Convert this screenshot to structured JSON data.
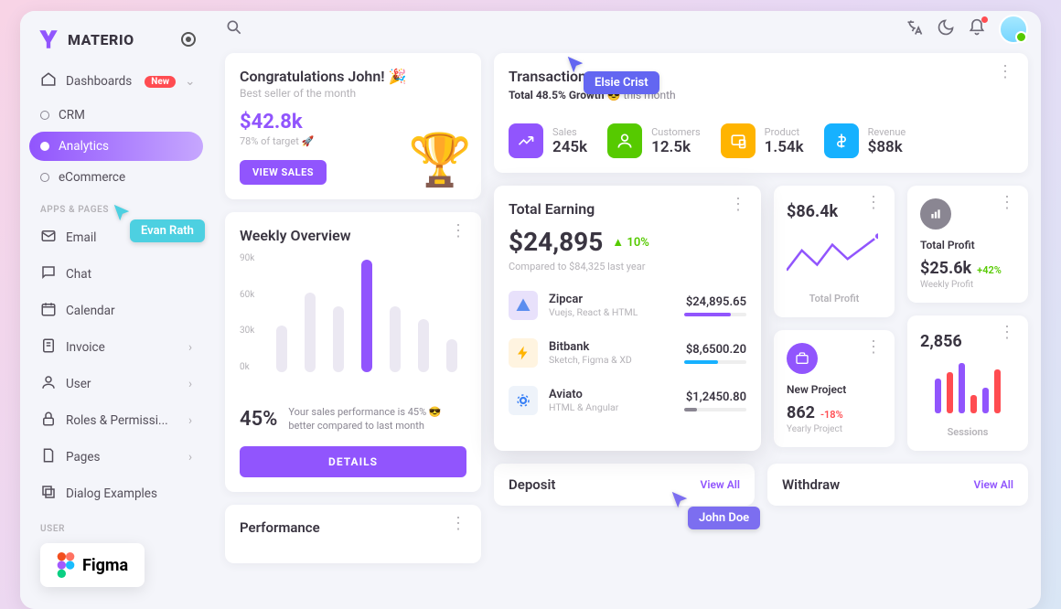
{
  "brand": "MATERIO",
  "sidebar": {
    "dashboards": "Dashboards",
    "new_badge": "New",
    "crm": "CRM",
    "analytics": "Analytics",
    "ecommerce": "eCommerce",
    "apps_pages": "APPS & PAGES",
    "email": "Email",
    "chat": "Chat",
    "calendar": "Calendar",
    "invoice": "Invoice",
    "user": "User",
    "roles": "Roles & Permissi...",
    "pages": "Pages",
    "dialog": "Dialog Examples",
    "ui_section": "USER"
  },
  "congrats": {
    "title": "Congratulations John! 🎉",
    "subtitle": "Best seller of the month",
    "value": "$42.8k",
    "target": "78% of target 🚀",
    "button": "VIEW SALES"
  },
  "weekly": {
    "title": "Weekly Overview",
    "ylabels": [
      "90k",
      "60k",
      "30k",
      "0k"
    ],
    "percent": "45%",
    "text": "Your sales performance is 45% 😎 better compared to last month",
    "button": "DETAILS"
  },
  "performance": {
    "title": "Performance"
  },
  "transactions": {
    "title": "Transactions",
    "growth_prefix": "Total 48.5% Growth",
    "growth_emoji": "😎",
    "growth_suffix": "this month",
    "stats": [
      {
        "label": "Sales",
        "value": "245k",
        "color": "#9155FD",
        "icon": "trend"
      },
      {
        "label": "Customers",
        "value": "12.5k",
        "color": "#56CA00",
        "icon": "user"
      },
      {
        "label": "Product",
        "value": "1.54k",
        "color": "#FFB400",
        "icon": "device"
      },
      {
        "label": "Revenue",
        "value": "$88k",
        "color": "#16B1FF",
        "icon": "dollar"
      }
    ]
  },
  "earning": {
    "title": "Total Earning",
    "value": "$24,895",
    "growth": "10%",
    "compared": "Compared to $84,325 last year",
    "rows": [
      {
        "name": "Zipcar",
        "tech": "Vuejs, React & HTML",
        "amount": "$24,895.65",
        "color": "#9155FD",
        "fill": 75,
        "bg": "#e8e1fb"
      },
      {
        "name": "Bitbank",
        "tech": "Sketch, Figma & XD",
        "amount": "$8,6500.20",
        "color": "#16B1FF",
        "fill": 55,
        "bg": "#fff4e0"
      },
      {
        "name": "Aviato",
        "tech": "HTML & Angular",
        "amount": "$1,2450.80",
        "color": "#8a8692",
        "fill": 20,
        "bg": "#eef3fa"
      }
    ]
  },
  "small1": {
    "value": "$86.4k",
    "label": "Total Profit"
  },
  "small2": {
    "label": "Total Profit",
    "value": "$25.6k",
    "growth": "+42%",
    "sub": "Weekly Profit"
  },
  "small3": {
    "label": "New Project",
    "value": "862",
    "growth": "-18%",
    "sub": "Yearly Project"
  },
  "small4": {
    "value": "2,856",
    "label": "Sessions"
  },
  "deposit": {
    "title": "Deposit",
    "viewall": "View All"
  },
  "withdraw": {
    "title": "Withdraw",
    "viewall": "View All"
  },
  "cursors": {
    "elsie": "Elsie Crist",
    "evan": "Evan Rath",
    "john": "John Doe"
  },
  "figma": "Figma",
  "chart_data": {
    "weekly_overview": {
      "type": "bar",
      "ylim": [
        0,
        90
      ],
      "ylabel": "k",
      "values": [
        35,
        60,
        50,
        85,
        50,
        40,
        25
      ],
      "highlight_index": 3
    },
    "total_profit_spark": {
      "type": "line",
      "points": [
        10,
        45,
        20,
        55,
        30,
        50,
        70
      ]
    },
    "sessions_bars": {
      "type": "bar",
      "series": [
        {
          "color": "#9155FD",
          "values": [
            38,
            55,
            28
          ]
        },
        {
          "color": "#ff4c51",
          "values": [
            45,
            20,
            48
          ]
        }
      ]
    }
  }
}
